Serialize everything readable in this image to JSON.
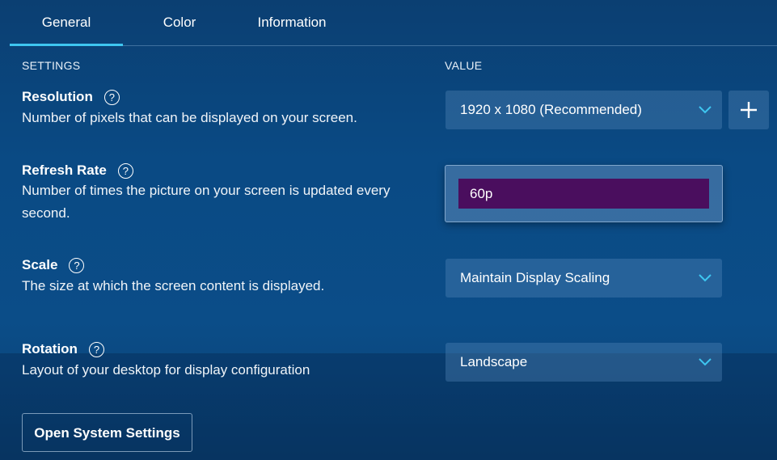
{
  "tabs": [
    {
      "label": "General",
      "active": true
    },
    {
      "label": "Color",
      "active": false
    },
    {
      "label": "Information",
      "active": false
    }
  ],
  "headers": {
    "settings": "SETTINGS",
    "value": "VALUE"
  },
  "help_icon_glyph": "?",
  "settings": {
    "resolution": {
      "title": "Resolution",
      "description": "Number of pixels that can be displayed on your screen.",
      "value": "1920 x 1080 (Recommended)",
      "icons": [
        "help-icon",
        "chevron-down-icon",
        "plus-icon"
      ]
    },
    "refresh_rate": {
      "title": "Refresh Rate",
      "description": "Number of times the picture on your screen is updated every second.",
      "value": "60p",
      "icons": [
        "help-icon"
      ]
    },
    "scale": {
      "title": "Scale",
      "description": "The size at which the screen content is displayed.",
      "value": "Maintain Display Scaling",
      "icons": [
        "help-icon",
        "chevron-down-icon"
      ]
    },
    "rotation": {
      "title": "Rotation",
      "description": "Layout of your desktop for display configuration",
      "value": "Landscape",
      "icons": [
        "help-icon",
        "chevron-down-icon"
      ]
    }
  },
  "open_system_settings_label": "Open System Settings",
  "colors": {
    "accent": "#3ec6f0",
    "selected_option": "#4a0e5e",
    "background": "#0b4d88"
  }
}
